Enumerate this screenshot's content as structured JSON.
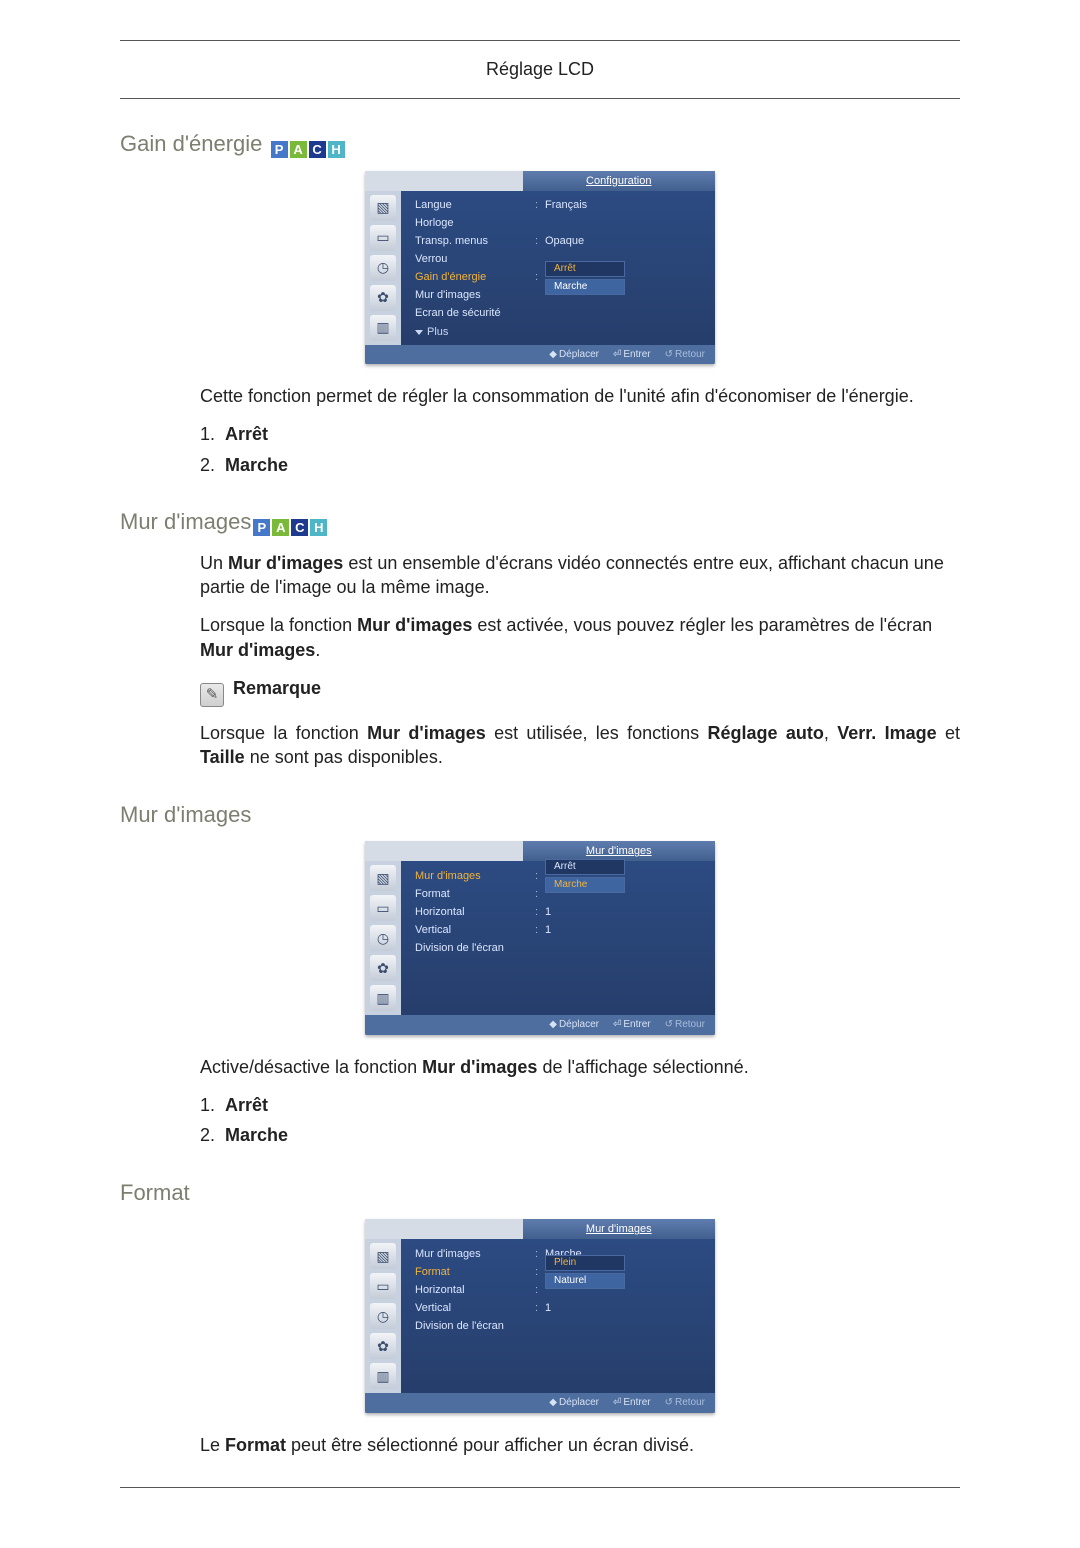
{
  "header": {
    "title": "Réglage LCD"
  },
  "pach": {
    "p": "P",
    "a": "A",
    "c": "C",
    "h": "H"
  },
  "sections": {
    "s1": {
      "title": "Gain d'énergie",
      "para1": "Cette fonction permet de régler la consommation de l'unité afin d'économiser de l'énergie.",
      "li1_num": "1.",
      "li1": "Arrêt",
      "li2_num": "2.",
      "li2": "Marche"
    },
    "s2": {
      "title": "Mur d'images",
      "para1_a": "Un ",
      "para1_b": "Mur d'images",
      "para1_c": " est un ensemble d'écrans vidéo connectés entre eux, affichant chacun une partie de l'image ou la même image.",
      "para2_a": "Lorsque la fonction ",
      "para2_b": "Mur d'images",
      "para2_c": " est activée, vous pouvez régler les paramètres de l'écran ",
      "para2_d": "Mur d'images",
      "para2_e": ".",
      "note_label": "Remarque",
      "para3_a": "Lorsque la fonction ",
      "para3_b": "Mur d'images",
      "para3_c": " est utilisée, les fonctions ",
      "para3_d": "Réglage auto",
      "para3_e": ", ",
      "para3_f": "Verr. Image",
      "para3_g": " et ",
      "para3_h": "Taille",
      "para3_i": " ne sont pas disponibles."
    },
    "s3": {
      "title": "Mur d'images",
      "para1_a": "Active/désactive la fonction ",
      "para1_b": "Mur d'images",
      "para1_c": " de l'affichage sélectionné.",
      "li1_num": "1.",
      "li1": "Arrêt",
      "li2_num": "2.",
      "li2": "Marche"
    },
    "s4": {
      "title": "Format",
      "para1_a": "Le ",
      "para1_b": "Format",
      "para1_c": " peut être sélectionné pour afficher un écran divisé."
    }
  },
  "osd": {
    "footer": {
      "move": "Déplacer",
      "enter": "Entrer",
      "return": "Retour"
    },
    "menu1": {
      "title": "Configuration",
      "r1_l": "Langue",
      "r1_v": "Français",
      "r2_l": "Horloge",
      "r3_l": "Transp. menus",
      "r3_v": "Opaque",
      "r4_l": "Verrou",
      "r5_l": "Gain d'énergie",
      "r5_o1": "Arrêt",
      "r5_o2": "Marche",
      "r6_l": "Mur d'images",
      "r7_l": "Ecran de sécurité",
      "plus": "Plus"
    },
    "menu2": {
      "title": "Mur d'images",
      "r1_l": "Mur d'images",
      "r1_o1": "Arrêt",
      "r1_o2": "Marche",
      "r2_l": "Format",
      "r3_l": "Horizontal",
      "r3_v": "1",
      "r4_l": "Vertical",
      "r4_v": "1",
      "r5_l": "Division de l'écran"
    },
    "menu3": {
      "title": "Mur d'images",
      "r1_l": "Mur d'images",
      "r1_v": "Marche",
      "r2_l": "Format",
      "r2_o1": "Plein",
      "r2_o2": "Naturel",
      "r3_l": "Horizontal",
      "r4_l": "Vertical",
      "r4_v": "1",
      "r5_l": "Division de l'écran"
    }
  }
}
